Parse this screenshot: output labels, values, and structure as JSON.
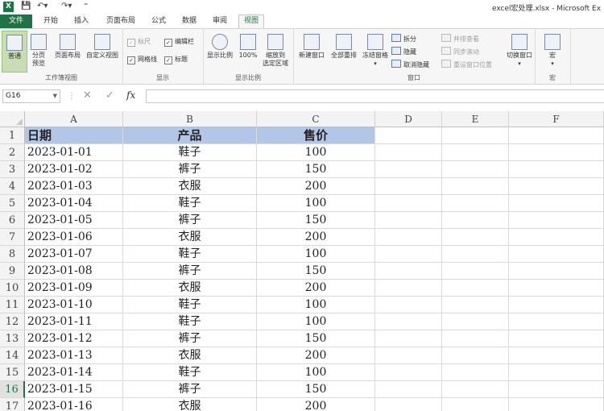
{
  "window": {
    "title": "excel宏处理.xlsx - Microsoft Ex",
    "app_icon_letter": "X",
    "qat": [
      "save-icon",
      "undo-icon",
      "redo-icon",
      "customize-icon"
    ]
  },
  "tabs": [
    {
      "label": "文件",
      "kind": "file"
    },
    {
      "label": "开始"
    },
    {
      "label": "插入"
    },
    {
      "label": "页面布局"
    },
    {
      "label": "公式"
    },
    {
      "label": "数据"
    },
    {
      "label": "审阅"
    },
    {
      "label": "视图",
      "active": true
    }
  ],
  "ribbon": {
    "workbook_views": {
      "label": "工作簿视图",
      "normal": "普通",
      "page_break": "分页\n预览",
      "page_layout": "页面布局",
      "custom": "自定义视图"
    },
    "show": {
      "label": "显示",
      "ruler": "标尺",
      "formula_bar": "编辑栏",
      "gridlines": "网格线",
      "headings": "标题"
    },
    "zoom": {
      "label": "显示比例",
      "zoom": "显示比例",
      "hundred": "100%",
      "zoom_to_selection": "缩放到\n选定区域"
    },
    "window": {
      "label": "窗口",
      "new_window": "新建窗口",
      "arrange_all": "全部重排",
      "freeze_panes": "冻结窗格",
      "split": "拆分",
      "hide": "隐藏",
      "unhide": "取消隐藏",
      "side_by_side": "并排查看",
      "sync_scroll": "同步滚动",
      "reset_position": "重设窗口位置",
      "switch_windows": "切换窗口"
    },
    "macros": {
      "label": "宏",
      "macros": "宏"
    }
  },
  "formula_bar": {
    "name_box": "G16",
    "cancel_icon": "✕",
    "enter_icon": "✓",
    "fx": "fx",
    "content": ""
  },
  "columns": [
    "A",
    "B",
    "C",
    "D",
    "E",
    "F"
  ],
  "header_row": {
    "num": "1",
    "a": "日期",
    "b": "产品",
    "c": "售价"
  },
  "rows": [
    {
      "num": "2",
      "a": "2023-01-01",
      "b": "鞋子",
      "c": "100"
    },
    {
      "num": "3",
      "a": "2023-01-02",
      "b": "裤子",
      "c": "150"
    },
    {
      "num": "4",
      "a": "2023-01-03",
      "b": "衣服",
      "c": "200"
    },
    {
      "num": "5",
      "a": "2023-01-04",
      "b": "鞋子",
      "c": "100"
    },
    {
      "num": "6",
      "a": "2023-01-05",
      "b": "裤子",
      "c": "150"
    },
    {
      "num": "7",
      "a": "2023-01-06",
      "b": "衣服",
      "c": "200"
    },
    {
      "num": "8",
      "a": "2023-01-07",
      "b": "鞋子",
      "c": "100"
    },
    {
      "num": "9",
      "a": "2023-01-08",
      "b": "裤子",
      "c": "150"
    },
    {
      "num": "10",
      "a": "2023-01-09",
      "b": "衣服",
      "c": "200"
    },
    {
      "num": "11",
      "a": "2023-01-10",
      "b": "鞋子",
      "c": "100"
    },
    {
      "num": "12",
      "a": "2023-01-11",
      "b": "鞋子",
      "c": "100"
    },
    {
      "num": "13",
      "a": "2023-01-12",
      "b": "裤子",
      "c": "150"
    },
    {
      "num": "14",
      "a": "2023-01-13",
      "b": "衣服",
      "c": "200"
    },
    {
      "num": "15",
      "a": "2023-01-14",
      "b": "鞋子",
      "c": "100"
    },
    {
      "num": "16",
      "a": "2023-01-15",
      "b": "裤子",
      "c": "150",
      "active": true
    },
    {
      "num": "17",
      "a": "2023-01-16",
      "b": "衣服",
      "c": "200"
    }
  ],
  "colors": {
    "brand": "#217346",
    "header_fill": "#b4c6e7",
    "ribbon_bg": "#f6f6f6"
  }
}
